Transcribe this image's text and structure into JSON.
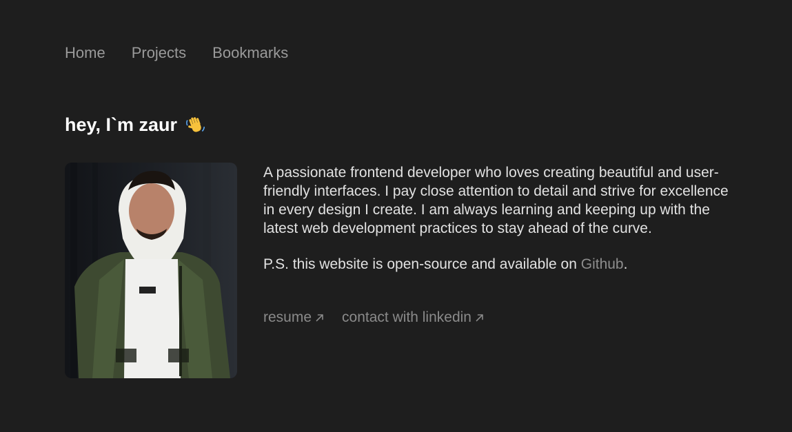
{
  "nav": {
    "items": [
      {
        "label": "Home"
      },
      {
        "label": "Projects"
      },
      {
        "label": "Bookmarks"
      }
    ]
  },
  "hero": {
    "greeting": "hey, I`m zaur",
    "wave_icon": "waving-hand-icon"
  },
  "bio": {
    "paragraph": "A passionate frontend developer who loves creating beautiful and user-friendly interfaces. I pay close attention to detail and strive for excellence in every design I create. I am always learning and keeping up with the latest web development practices to stay ahead of the curve.",
    "ps_prefix": "P.S. this website is open-source and available on ",
    "ps_link": "Github",
    "ps_suffix": "."
  },
  "links": {
    "resume": "resume",
    "linkedin": "contact with linkedin",
    "icon": "arrow-up-right-icon"
  },
  "colors": {
    "background": "#1e1e1e",
    "text": "#e2e2e2",
    "muted": "#8a8a8a",
    "heading": "#ffffff"
  }
}
